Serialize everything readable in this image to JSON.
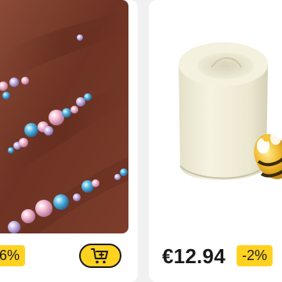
{
  "products": [
    {
      "image_icon": "pearl-beads-photo",
      "price": "",
      "discount": "6%",
      "cart_icon": "add-to-cart-icon"
    },
    {
      "image_icon": "silicone-mold-photo",
      "price": "€12.94",
      "discount": "-2%"
    }
  ],
  "colors": {
    "badge": "#ffd21f",
    "fabric": "#7a3a2a",
    "text": "#1a1a1a"
  }
}
